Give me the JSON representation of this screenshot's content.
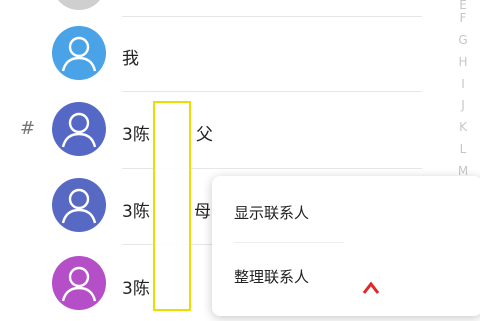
{
  "contacts": [
    {
      "name": "我",
      "color": "#4aa3e6"
    },
    {
      "name": "3陈",
      "suffix": "父",
      "color": "#5668c6"
    },
    {
      "name": "3陈",
      "suffix": "母",
      "color": "#5869c4"
    },
    {
      "name": "3陈",
      "suffix": "",
      "color": "#b54fc8"
    }
  ],
  "section_letter": "#",
  "index_letters": [
    "E",
    "F",
    "G",
    "H",
    "I",
    "J",
    "K",
    "L",
    "M"
  ],
  "menu": {
    "items": [
      "显示联系人",
      "整理联系人"
    ]
  },
  "colors": {
    "highlight": "#e8e000",
    "top_avatar": "#cfcfcf"
  }
}
